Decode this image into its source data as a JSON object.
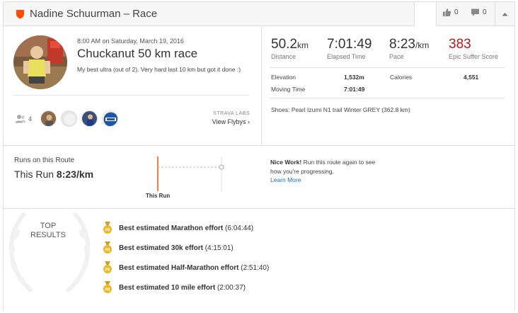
{
  "header": {
    "title": "Nadine Schuurman – Race",
    "kudos_count": "0",
    "comment_count": "0"
  },
  "activity": {
    "datetime": "8:00 AM on Saturday, March 19, 2016",
    "name": "Chuckanut 50 km race",
    "description": "My best ultra (out of 2). Very hard last 10 km but got it done :)",
    "athlete_count": "4",
    "strava_labs": "STRAVA LABS",
    "flyby_link": "View Flybys ›"
  },
  "stats": {
    "distance": {
      "value": "50.2",
      "unit": "km",
      "label": "Distance"
    },
    "elapsed": {
      "value": "7:01:49",
      "label": "Elapsed Time"
    },
    "pace": {
      "value": "8:23",
      "unit": "/km",
      "label": "Pace"
    },
    "suffer": {
      "value": "383",
      "label": "Epic Suffer Score"
    },
    "elevation_label": "Elevation",
    "elevation_value": "1,532m",
    "calories_label": "Calories",
    "calories_value": "4,551",
    "moving_label": "Moving Time",
    "moving_value": "7:01:49",
    "shoes": "Shoes: Pearl Izumi N1 trail Winter GREY (362.8 km)"
  },
  "route": {
    "title": "Runs on this Route",
    "this_run_prefix": "This Run",
    "this_run_pace": "8:23/km",
    "marker_label": "This Run",
    "nice_bold": "Nice Work!",
    "nice_text": " Run this route again to see how you're progressing.",
    "learn_more": "Learn More"
  },
  "results": {
    "label_line1": "TOP",
    "label_line2": "RESULTS",
    "items": [
      {
        "bold": "Best estimated Marathon effort",
        "time": " (6:04:44)"
      },
      {
        "bold": "Best estimated 30k effort",
        "time": " (4:15:01)"
      },
      {
        "bold": "Best estimated Half-Marathon effort",
        "time": " (2:51:40)"
      },
      {
        "bold": "Best estimated 10 mile effort",
        "time": " (2:00:37)"
      }
    ],
    "medal_text": "PR"
  },
  "colors": {
    "brand_orange": "#fc4c02",
    "suffer_red": "#b31b1b",
    "link_blue": "#1a6fb6",
    "medal_gold": "#e8b92a"
  }
}
